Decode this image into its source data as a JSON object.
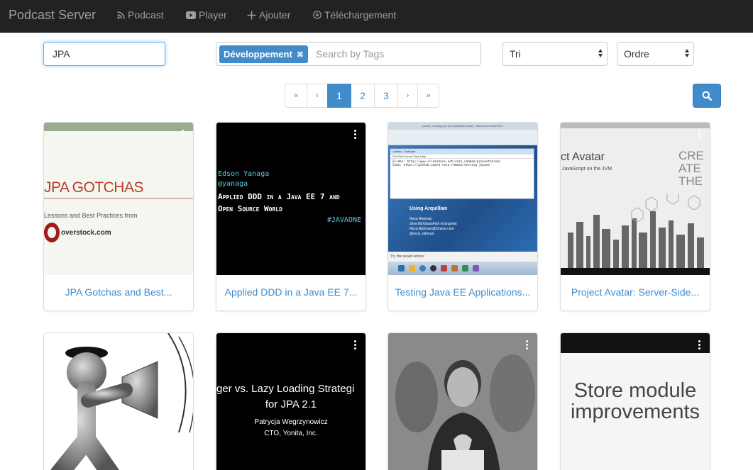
{
  "navbar": {
    "brand": "Podcast Server",
    "items": [
      {
        "label": "Podcast",
        "icon": "rss-icon"
      },
      {
        "label": "Player",
        "icon": "youtube-play-icon"
      },
      {
        "label": "Ajouter",
        "icon": "plus-icon"
      },
      {
        "label": "Téléchargement",
        "icon": "download-icon"
      }
    ]
  },
  "search": {
    "value": "JPA"
  },
  "tags": {
    "selected": [
      "Développement"
    ],
    "remove_glyph": "✖",
    "placeholder": "Search by Tags"
  },
  "sort": {
    "selected": "Tri"
  },
  "order": {
    "selected": "Ordre"
  },
  "pagination": {
    "first": "«",
    "prev": "‹",
    "pages": [
      "1",
      "2",
      "3"
    ],
    "active": "1",
    "next": "›",
    "last": "»"
  },
  "search_button": {
    "icon": "search-icon"
  },
  "colors": {
    "accent": "#428bca",
    "navbar": "#222222"
  },
  "cards": [
    {
      "title": "JPA Gotchas and Best...",
      "thumb": {
        "headline": "JPA GOTCHAS",
        "subline": "Lessons and Best Practices from",
        "logo": "overstock.com"
      }
    },
    {
      "title": "Applied DDD in a Java EE 7...",
      "thumb": {
        "author": "Edson Yanaga",
        "handle": "@yanaga",
        "line1": "Applied DDD in a Java EE 7 and",
        "line2": "Open Source World",
        "hashtag": "#JAVAONE"
      }
    },
    {
      "title": "Testing Java EE Applications...",
      "thumb": {
        "window_title": "Untitled - Notepad",
        "app_title": "javaee_testing.pptx [Compatibility Mode] - Microsoft PowerPoint",
        "menu": "File  Edit  Format  View  Help",
        "line1": "Slides: http://www.slideshare.net/reza_rahman/presentations",
        "line2": "Code: https://github.com/m-reza-rahman/testing-javaee",
        "slide_title": "Using Arquillian",
        "presenter": "Reza Rahman",
        "role": "Java EE/GlassFish Evangelist",
        "email": "Reza.Rahman@Oracle.com",
        "twitter": "@reza_rahman",
        "footer": "Try 'the seakd entries'"
      }
    },
    {
      "title": "Project Avatar: Server-Side...",
      "thumb": {
        "headline": "ct Avatar",
        "subline": "JavaScript on the JVM",
        "side": "CREATE THE FUTU"
      }
    },
    {
      "title": "",
      "thumb": {}
    },
    {
      "title": "",
      "thumb": {
        "line1": "ger vs. Lazy Loading Strategi",
        "line2": "for JPA 2.1",
        "author": "Patrycja Wegrzynowicz",
        "role": "CTO, Yonita, Inc."
      }
    },
    {
      "title": "",
      "thumb": {}
    },
    {
      "title": "",
      "thumb": {
        "line1": "Store module",
        "line2": "improvements"
      }
    }
  ]
}
